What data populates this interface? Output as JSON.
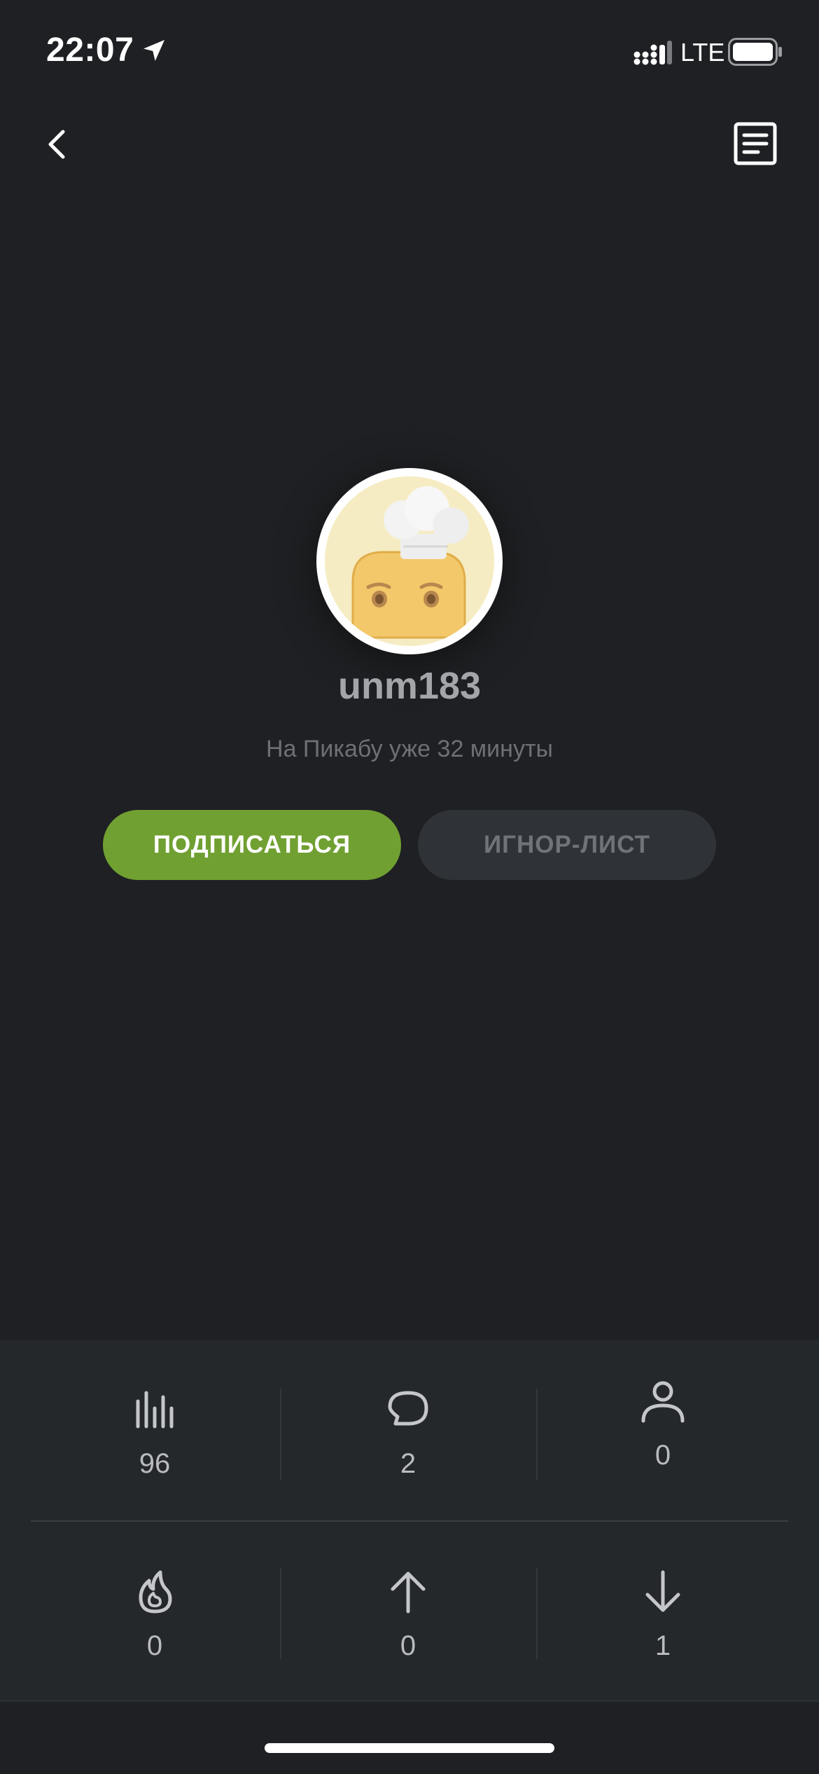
{
  "status_bar": {
    "time": "22:07",
    "network": "LTE",
    "icons": [
      "location-arrow-icon",
      "signal-icon",
      "battery-icon"
    ]
  },
  "header": {
    "back_icon": "chevron-left-icon",
    "notes_icon": "notes-icon"
  },
  "profile": {
    "username": "unm183",
    "member_since": "На Пикабу уже 32 минуты"
  },
  "actions": {
    "subscribe_label": "ПОДПИСАТЬСЯ",
    "ignore_label": "ИГНОР-ЛИСТ"
  },
  "stats": {
    "row1": [
      {
        "icon": "rating-bars-icon",
        "value": "96"
      },
      {
        "icon": "comment-icon",
        "value": "2"
      },
      {
        "icon": "user-icon",
        "value": "0"
      }
    ],
    "row2": [
      {
        "icon": "fire-icon",
        "value": "0"
      },
      {
        "icon": "arrow-up-icon",
        "value": "0"
      },
      {
        "icon": "arrow-down-icon",
        "value": "1"
      }
    ]
  },
  "colors": {
    "background": "#1e2023",
    "accent_green": "#71a032",
    "panel": "#25282b",
    "muted_text": "#6d7074"
  }
}
